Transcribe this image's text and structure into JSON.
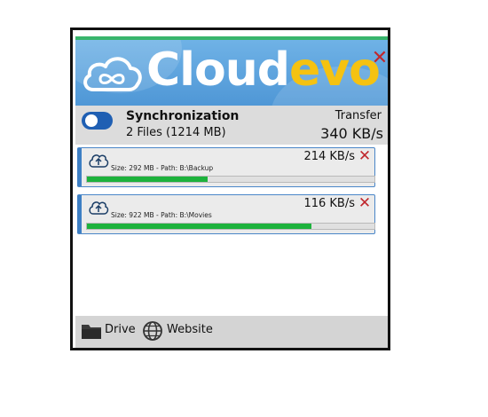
{
  "app": {
    "brand_part1": "Cloud",
    "brand_part2": "evo",
    "brand_colors": {
      "primary": "#ffffff",
      "accent": "#f5c211",
      "header_bg": "#5aa3df"
    },
    "close_symbol": "✕"
  },
  "sync": {
    "title": "Synchronization",
    "summary": "2 Files (1214 MB)",
    "enabled": true,
    "transfer_label": "Transfer",
    "transfer_value": "340 KB/s"
  },
  "transfers": [
    {
      "meta": "Size: 292 MB - Path: B:\\Backup",
      "speed": "214 KB/s",
      "progress": 0.42,
      "icon": "cloud-upload-icon"
    },
    {
      "meta": "Size: 922 MB - Path: B:\\Movies",
      "speed": "116 KB/s",
      "progress": 0.78,
      "icon": "cloud-upload-icon"
    }
  ],
  "footer": {
    "drive_label": "Drive",
    "drive_icon": "folder-icon",
    "website_label": "Website",
    "website_icon": "globe-icon"
  },
  "colors": {
    "progress": "#1db23c",
    "close": "#c0272d",
    "toggle_on": "#1f5fb3"
  }
}
